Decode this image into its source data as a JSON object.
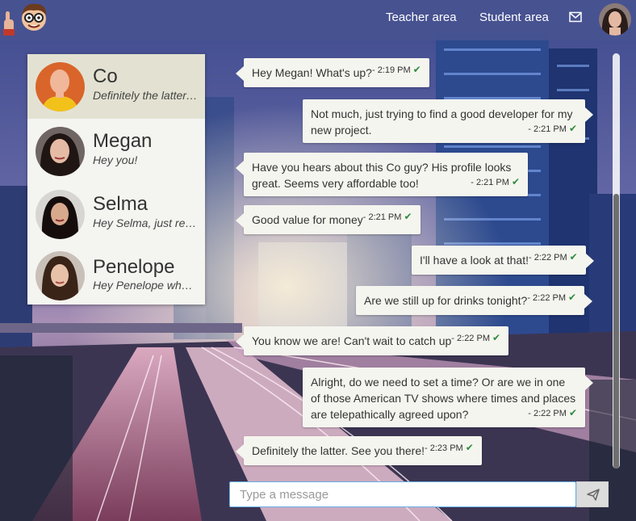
{
  "nav": {
    "teacher_area": "Teacher area",
    "student_area": "Student area"
  },
  "icons": {
    "logo": "thumbs-up-cartoon-face-logo",
    "mail": "envelope-icon",
    "send": "paper-plane-icon"
  },
  "colors": {
    "navbar": "#485291",
    "active_contact": "#e3e2d2",
    "bubble": "#f5f5ef",
    "read_check": "#2e8b3e",
    "input_focus_border": "#66afe9"
  },
  "contacts": [
    {
      "name": "Co",
      "preview": "Definitely the latter. See you there!",
      "active": true
    },
    {
      "name": "Megan",
      "preview": "Hey you!",
      "active": false
    },
    {
      "name": "Selma",
      "preview": "Hey Selma, just reminding you about tonight",
      "active": false
    },
    {
      "name": "Penelope",
      "preview": "Hey Penelope what's up?",
      "active": false
    }
  ],
  "messages": [
    {
      "side": "in",
      "text": "Hey Megan! What's up?",
      "time": "- 2:19 PM"
    },
    {
      "side": "out",
      "text": "Not much, just trying to find a good developer for my new project.",
      "time": "- 2:21 PM"
    },
    {
      "side": "in",
      "text": "Have you hears about this Co guy? His profile looks great. Seems very affordable too!",
      "time": "- 2:21 PM"
    },
    {
      "side": "in",
      "text": "Good value for money",
      "time": "- 2:21 PM"
    },
    {
      "side": "out",
      "text": "I'll have a look at that!",
      "time": "- 2:22 PM"
    },
    {
      "side": "out",
      "text": "Are we still up for drinks tonight?",
      "time": "- 2:22 PM"
    },
    {
      "side": "in",
      "text": "You know we are! Can't wait to catch up",
      "time": "- 2:22 PM"
    },
    {
      "side": "out",
      "text": "Alright, do we need to set a time? Or are we in one of those American TV shows where times and places are telepathically agreed upon?",
      "time": "- 2:22 PM"
    },
    {
      "side": "in",
      "text": "Definitely the latter. See you there!",
      "time": "- 2:23 PM"
    }
  ],
  "composer": {
    "placeholder": "Type a message",
    "value": ""
  }
}
